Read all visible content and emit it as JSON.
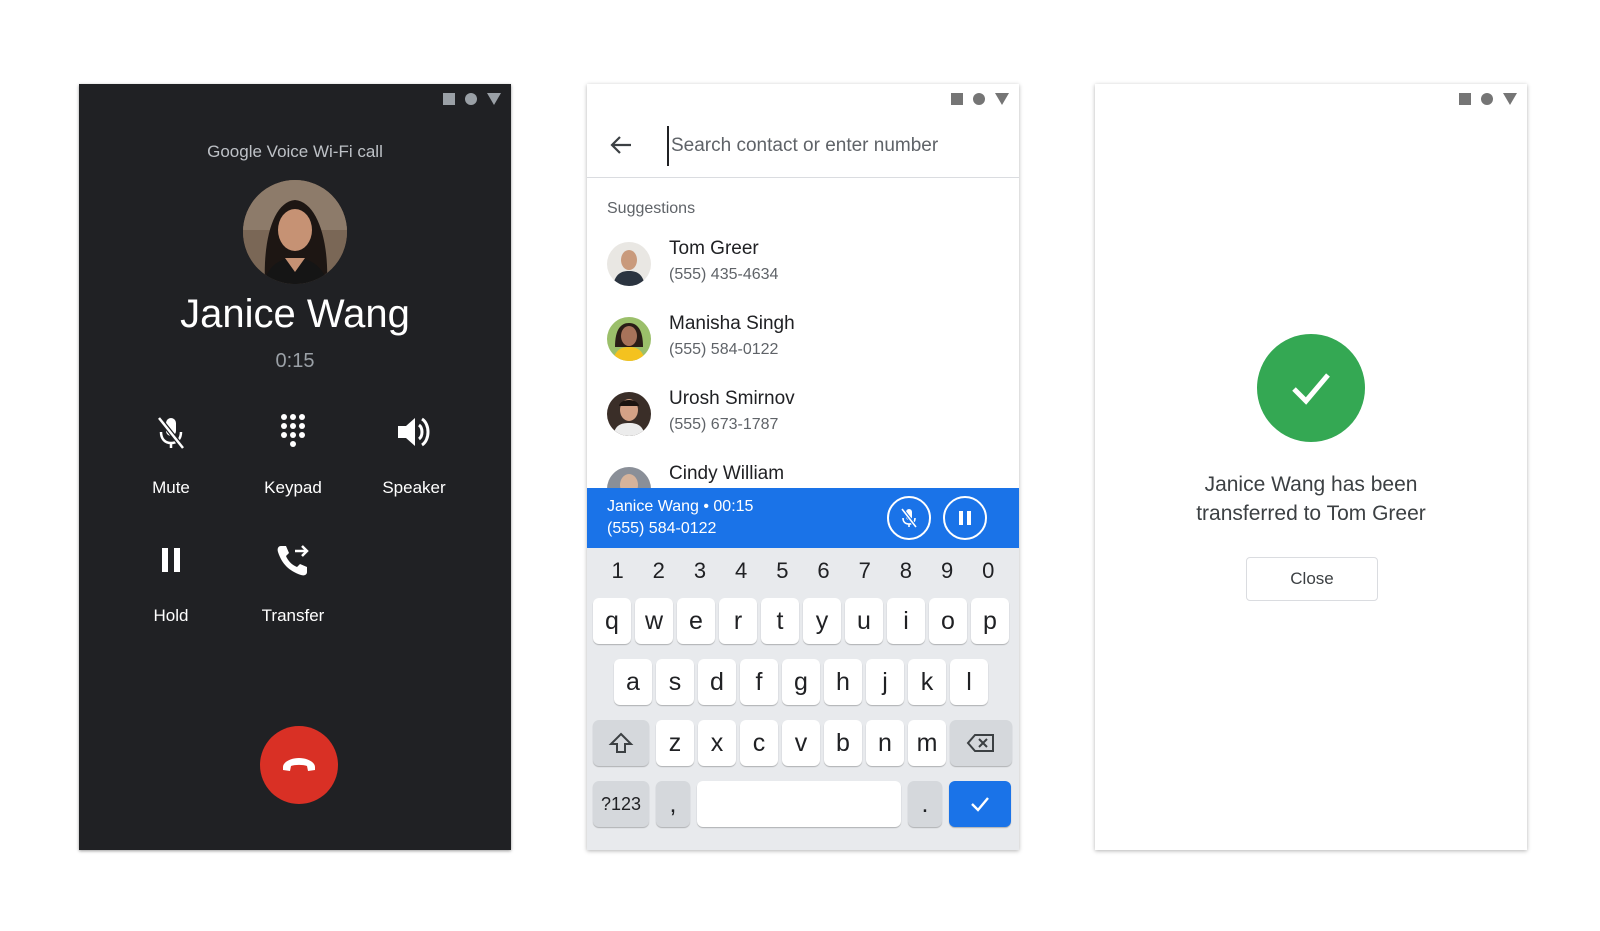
{
  "call_screen": {
    "call_type": "Google Voice Wi-Fi call",
    "caller_name": "Janice Wang",
    "timer": "0:15",
    "controls": {
      "mute": "Mute",
      "keypad": "Keypad",
      "speaker": "Speaker",
      "hold": "Hold",
      "transfer": "Transfer"
    },
    "end_call_color": "#d93025"
  },
  "transfer_screen": {
    "search": {
      "placeholder": "Search contact or enter number",
      "value": ""
    },
    "suggestions_title": "Suggestions",
    "contacts": [
      {
        "name": "Tom Greer",
        "phone": "(555) 435-4634"
      },
      {
        "name": "Manisha Singh",
        "phone": "(555) 584-0122"
      },
      {
        "name": "Urosh Smirnov",
        "phone": "(555) 673-1787"
      },
      {
        "name": "Cindy William",
        "phone": ""
      }
    ],
    "ongoing_call": {
      "title": "Janice Wang • 00:15",
      "phone": "(555) 584-0122",
      "color": "#1a73e8"
    },
    "keyboard": {
      "numbers": [
        "1",
        "2",
        "3",
        "4",
        "5",
        "6",
        "7",
        "8",
        "9",
        "0"
      ],
      "row1": [
        "q",
        "w",
        "e",
        "r",
        "t",
        "y",
        "u",
        "i",
        "o",
        "p"
      ],
      "row2": [
        "a",
        "s",
        "d",
        "f",
        "g",
        "h",
        "j",
        "k",
        "l"
      ],
      "row3": [
        "z",
        "x",
        "c",
        "v",
        "b",
        "n",
        "m"
      ],
      "symbols_key": "?123",
      "comma_key": ",",
      "period_key": "."
    }
  },
  "done_screen": {
    "message_line1": "Janice Wang has been",
    "message_line2": "transferred to Tom Greer",
    "close_label": "Close",
    "success_color": "#34a853"
  }
}
